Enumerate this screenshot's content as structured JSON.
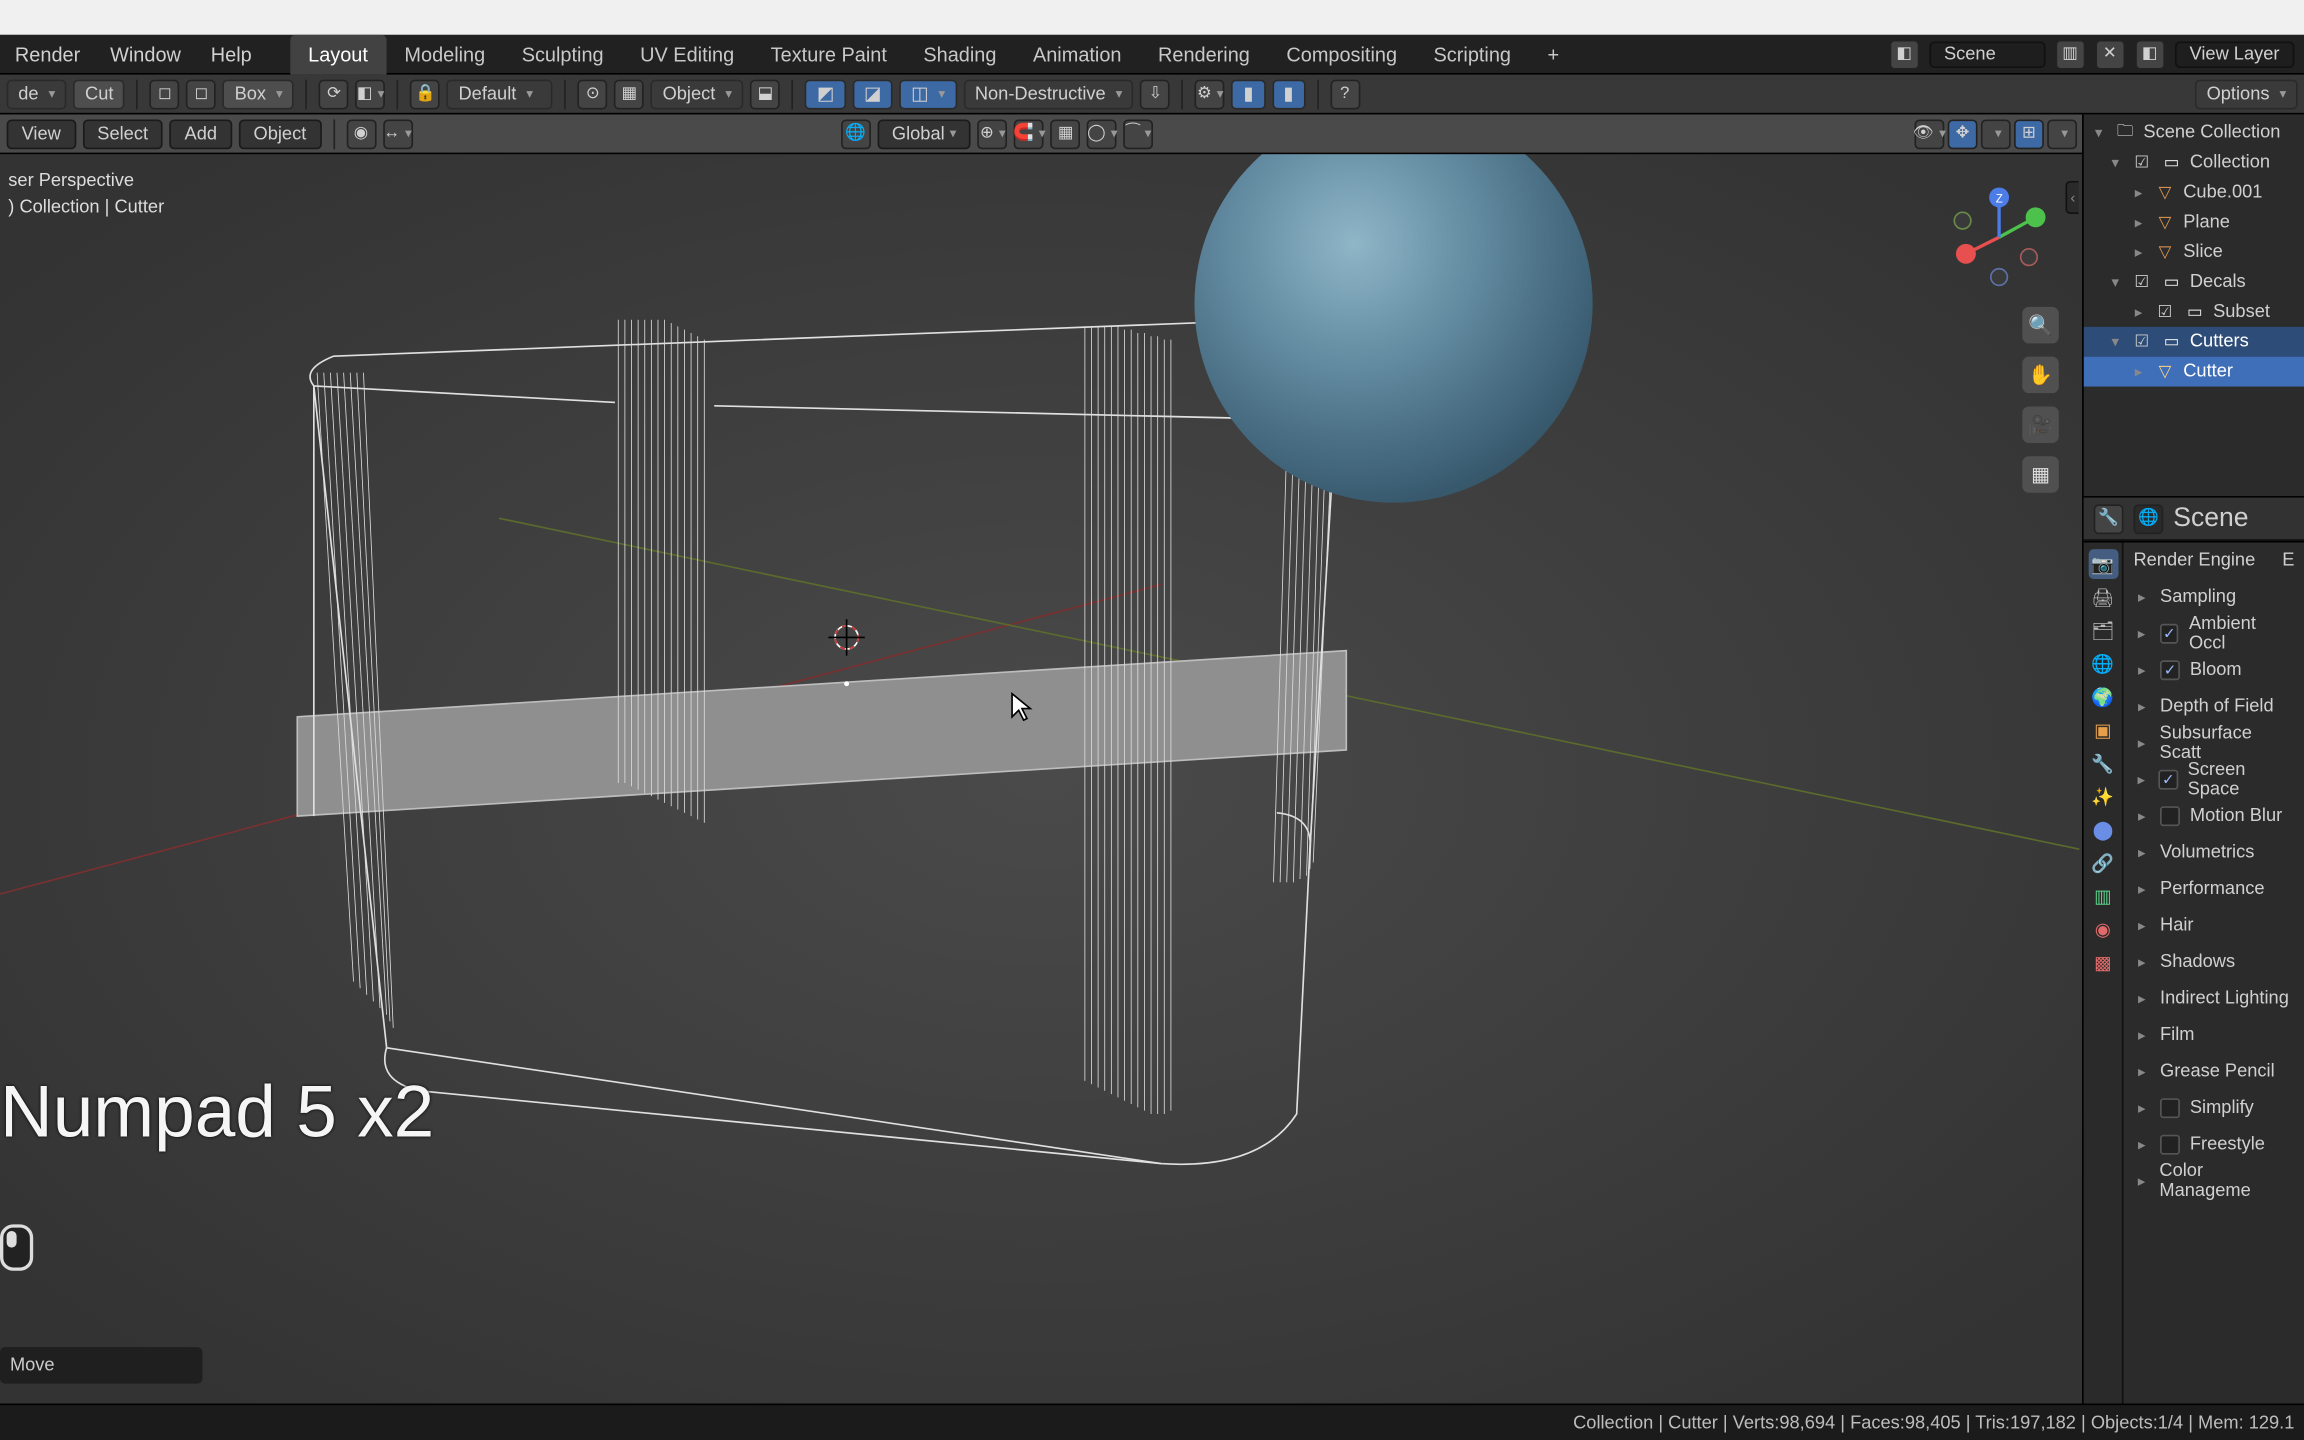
{
  "menus": {
    "render": "Render",
    "window": "Window",
    "help": "Help"
  },
  "workspaces": [
    "Layout",
    "Modeling",
    "Sculpting",
    "UV Editing",
    "Texture Paint",
    "Shading",
    "Animation",
    "Rendering",
    "Compositing",
    "Scripting"
  ],
  "active_workspace": "Layout",
  "scene_name": "Scene",
  "view_layer": "View Layer",
  "toolbar2": {
    "mode_hint": "de",
    "cut": "Cut",
    "box": "Box",
    "default": "Default",
    "object": "Object",
    "nondestructive": "Non-Destructive",
    "global": "Global",
    "options": "Options"
  },
  "toolbar3": {
    "view": "View",
    "select": "Select",
    "add": "Add",
    "object": "Object"
  },
  "viewport": {
    "perspective": "ser Perspective",
    "breadcrumb": ") Collection | Cutter",
    "overlay": "Numpad 5 x2",
    "last_op": "Move"
  },
  "nav_gizmo": {
    "axes": [
      "X",
      "Y",
      "Z"
    ]
  },
  "outliner": {
    "root": "Scene Collection",
    "items": [
      {
        "label": "Collection",
        "kind": "coll",
        "depth": 0,
        "expanded": true,
        "checked": true
      },
      {
        "label": "Cube.001",
        "kind": "mesh",
        "depth": 1
      },
      {
        "label": "Plane",
        "kind": "mesh",
        "depth": 1
      },
      {
        "label": "Slice",
        "kind": "mesh",
        "depth": 1
      },
      {
        "label": "Decals",
        "kind": "coll",
        "depth": 0,
        "expanded": true,
        "checked": true
      },
      {
        "label": "Subset",
        "kind": "coll",
        "depth": 1
      },
      {
        "label": "Cutters",
        "kind": "coll",
        "depth": 0,
        "expanded": true,
        "checked": true,
        "selected": true
      },
      {
        "label": "Cutter",
        "kind": "mesh",
        "depth": 1,
        "active": true
      }
    ]
  },
  "properties": {
    "context": "Scene",
    "render_engine_label": "Render Engine",
    "render_engine_value": "E",
    "panels": [
      {
        "label": "Sampling"
      },
      {
        "label": "Ambient Occl",
        "checked": true
      },
      {
        "label": "Bloom",
        "checked": true
      },
      {
        "label": "Depth of Field"
      },
      {
        "label": "Subsurface Scatt"
      },
      {
        "label": "Screen Space",
        "checked": true
      },
      {
        "label": "Motion Blur",
        "checked": false
      },
      {
        "label": "Volumetrics"
      },
      {
        "label": "Performance"
      },
      {
        "label": "Hair"
      },
      {
        "label": "Shadows"
      },
      {
        "label": "Indirect Lighting"
      },
      {
        "label": "Film"
      },
      {
        "label": "Grease Pencil"
      },
      {
        "label": "Simplify",
        "checked": false
      },
      {
        "label": "Freestyle",
        "checked": false
      },
      {
        "label": "Color Manageme"
      }
    ]
  },
  "status": {
    "left": "",
    "right": "Collection | Cutter | Verts:98,694 | Faces:98,405 | Tris:197,182 | Objects:1/4 | Mem: 129.1"
  }
}
